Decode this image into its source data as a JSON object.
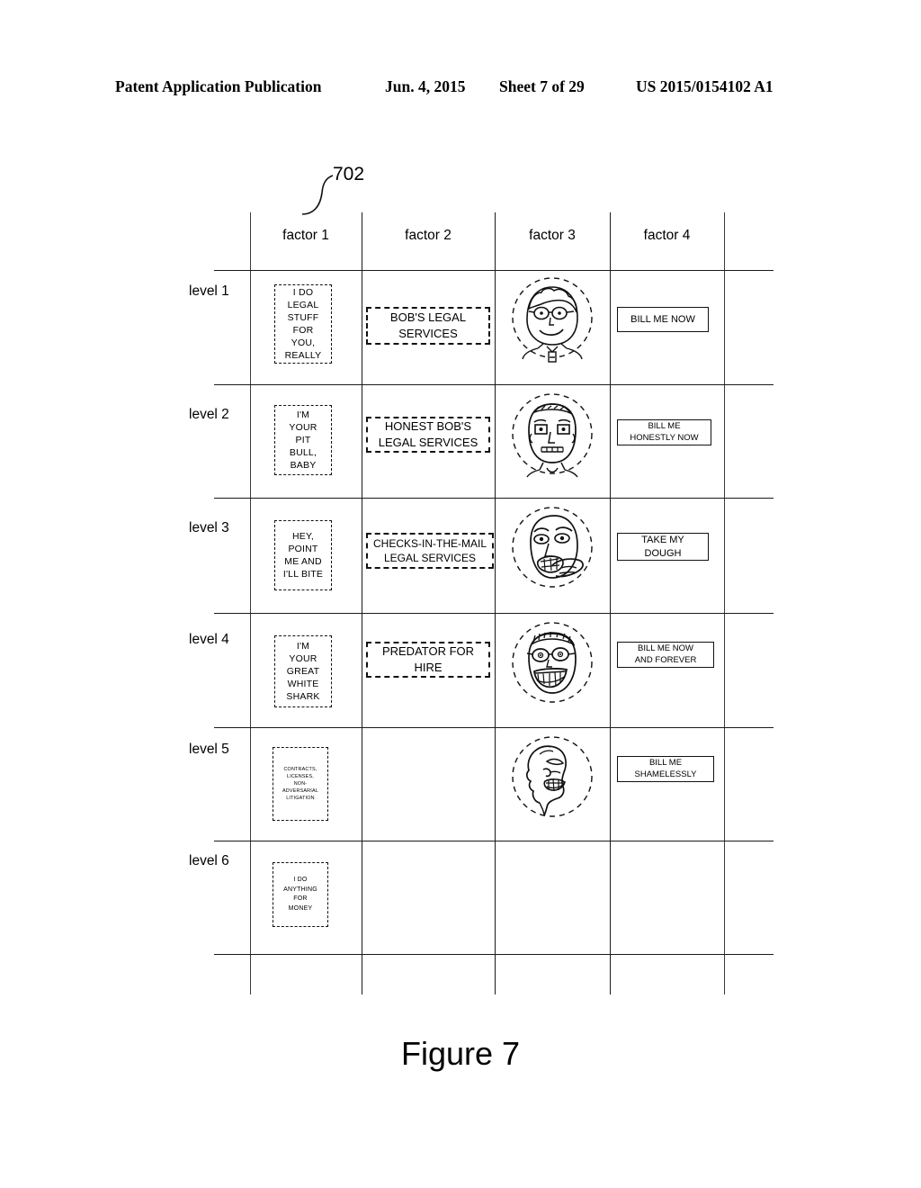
{
  "header": {
    "publication": "Patent Application Publication",
    "date": "Jun. 4, 2015",
    "sheet": "Sheet 7 of 29",
    "number": "US 2015/0154102 A1"
  },
  "figure": {
    "caption": "Figure 7",
    "reference_numeral": "702"
  },
  "table": {
    "column_headers": [
      "factor 1",
      "factor 2",
      "factor 3",
      "factor 4"
    ],
    "row_headers": [
      "level 1",
      "level 2",
      "level 3",
      "level 4",
      "level 5",
      "level 6"
    ],
    "rows": [
      {
        "level": "level 1",
        "factor1": "I DO\nLEGAL\nSTUFF\nFOR\nYOU,\nREALLY",
        "factor2": "BOB'S LEGAL\nSERVICES",
        "factor3": "friendly-face-with-glasses-and-tie",
        "factor4": "BILL ME NOW"
      },
      {
        "level": "level 2",
        "factor1": "I'M\nYOUR\nPIT\nBULL,\nBABY",
        "factor2": "HONEST BOB'S\nLEGAL SERVICES",
        "factor3": "stern-square-face",
        "factor4": "BILL ME\nHONESTLY NOW"
      },
      {
        "level": "level 3",
        "factor1": "HEY,\nPOINT\nME AND\nI'LL BITE",
        "factor2": "CHECKS-IN-THE-MAIL\nLEGAL SERVICES",
        "factor3": "angry-face-pointing",
        "factor4": "TAKE MY\nDOUGH"
      },
      {
        "level": "level 4",
        "factor1": "I'M\nYOUR\nGREAT\nWHITE\nSHARK",
        "factor2": "PREDATOR FOR\nHIRE",
        "factor3": "grinning-toothy-face-with-glasses",
        "factor4": "BILL ME NOW\nAND FOREVER"
      },
      {
        "level": "level 5",
        "factor1": "CONTRACTS,\nLICENSES,\nNON-\nADVERSARIAL\nLITIGATION",
        "factor2": "",
        "factor3": "profile-face-side-view",
        "factor4": "BILL ME\nSHAMELESSLY"
      },
      {
        "level": "level 6",
        "factor1": "I DO\nANYTHING\nFOR\nMONEY",
        "factor2": "",
        "factor3": "",
        "factor4": ""
      }
    ]
  }
}
